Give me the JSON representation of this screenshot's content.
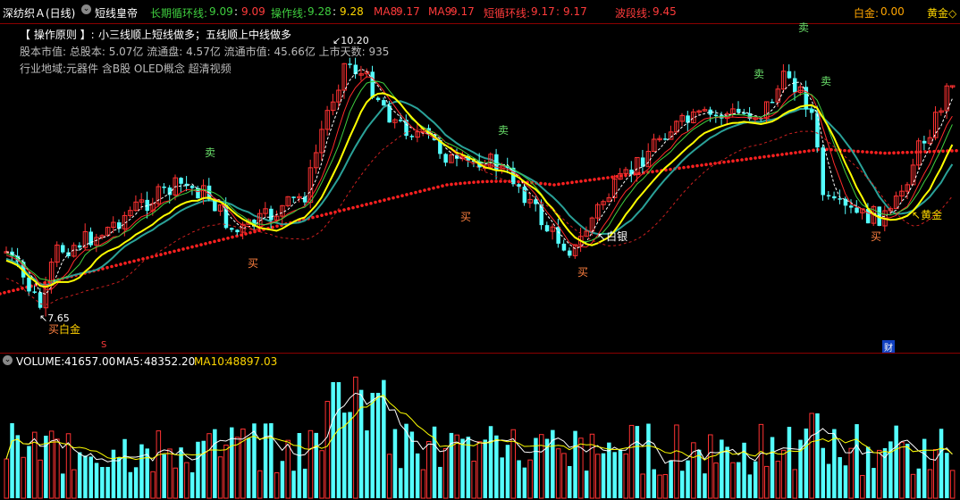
{
  "header": {
    "stock_name": "深纺织Ａ(日线)",
    "indicator_name": "短线皇帝",
    "long_cycle_label": "长期循环线:",
    "long_cycle_value": "9.09",
    "long_cycle_value2": "9.09",
    "operation_label": "操作线:",
    "operation_value": "9.28",
    "operation_value2": "9.28",
    "ma8_label": "MA8:",
    "ma8_value": "9.17",
    "ma9_label": "MA9:",
    "ma9_value": "9.17",
    "short_cycle_label": "短循环线:",
    "short_cycle_value": "9.17",
    "short_cycle_value2": "9.17",
    "wave_label": "波段线:",
    "wave_value": "9.45",
    "platinum_label": "白金:",
    "platinum_value": "0.00",
    "gold_label": "黄金◇"
  },
  "info": {
    "principle_prefix": "【 操作原则 】:",
    "principle_text": "小三线顺上短线做多；五线顺上中线做多",
    "capital_text": "股本市值: 总股本: 5.07亿 流通盘: 4.57亿 流通市值: 45.66亿 上市天数: 935",
    "industry_text": "行业地域:元器件      含B股 OLED概念 超清视频"
  },
  "chart_annotations": {
    "high_price": "10.20",
    "low_price": "7.65",
    "buy_label": "买",
    "sell_label": "卖",
    "platinum_mark": "白金",
    "silver_mark": "白银",
    "gold_mark": "黄金",
    "gold_signal_prefix": "↖",
    "bottom_marker_s": "S",
    "bottom_marker_fin": "财"
  },
  "volume_header": {
    "volume_label": "VOLUME:",
    "volume_value": "41657.00",
    "ma5_label": "MA5:",
    "ma5_value": "48352.20",
    "ma10_label": "MA10:",
    "ma10_value": "48897.03"
  },
  "colors": {
    "background": "#000000",
    "up_candle": "#ff3232",
    "down_candle": "#54ffff",
    "yellow_line": "#ffff00",
    "operation_line": "#ffffff",
    "wave_dots": "#ff2020",
    "teal_line": "#2aa198",
    "ma_white": "#ffffff",
    "ma_yellow": "#ffff00"
  }
}
